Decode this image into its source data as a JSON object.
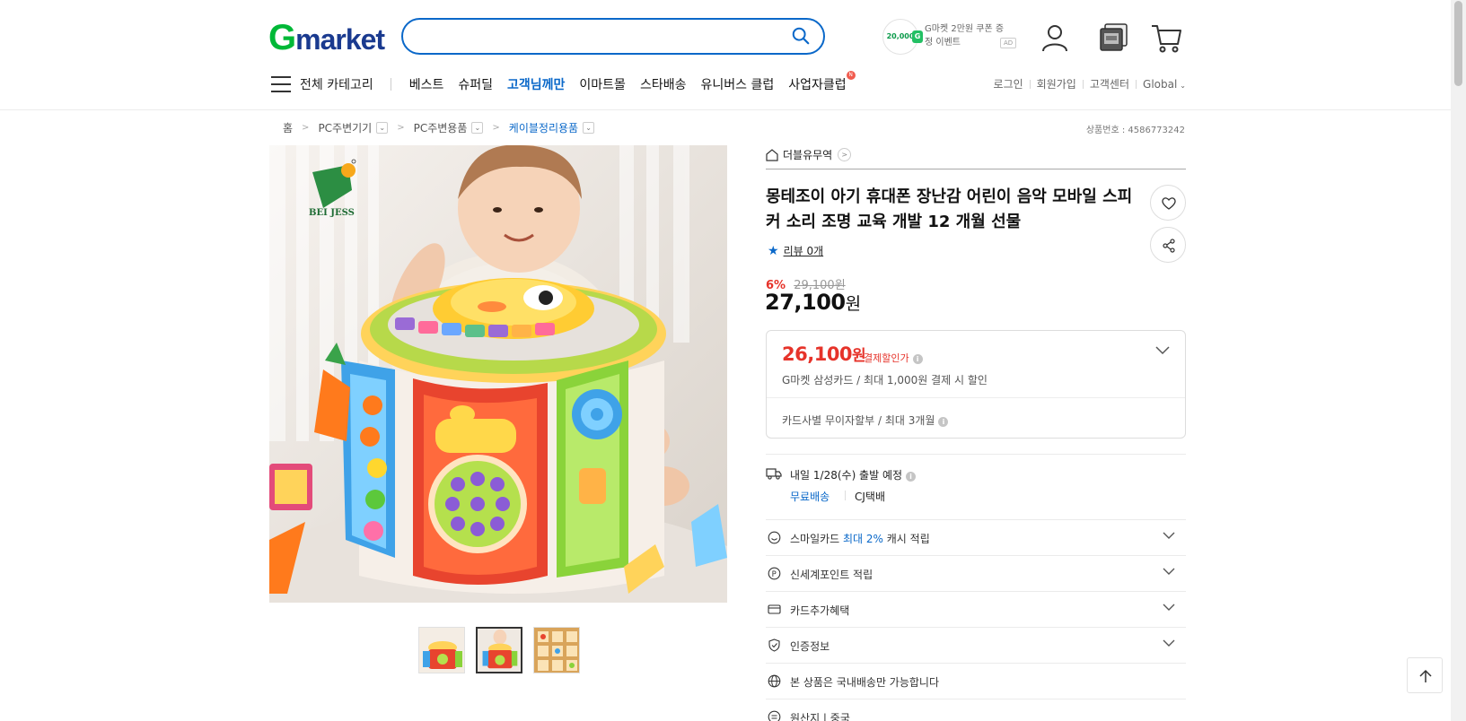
{
  "header": {
    "logo_g": "G",
    "logo_rest": "market",
    "search_placeholder": "",
    "promo_coin": "20,000",
    "promo_coin_g": "G",
    "promo_text": "G마켓 2만원 쿠폰 증정 이벤트",
    "ad_label": "AD"
  },
  "nav": {
    "category_label": "전체 카테고리",
    "items": [
      {
        "label": "베스트"
      },
      {
        "label": "슈퍼딜"
      },
      {
        "label": "고객님께만"
      },
      {
        "label": "이마트몰"
      },
      {
        "label": "스타배송"
      },
      {
        "label": "유니버스 클럽"
      },
      {
        "label": "사업자클럽"
      }
    ],
    "badge": "N",
    "util": [
      "로그인",
      "회원가입",
      "고객센터",
      "Global"
    ]
  },
  "breadcrumb": {
    "items": [
      "홈",
      "PC주변기기",
      "PC주변용품",
      "케이블정리용품"
    ],
    "product_number": "상품번호 : 4586773242"
  },
  "product": {
    "seller": "더블유무역",
    "title": "몽테조이 아기 휴대폰 장난감 어린이 음악 모바일 스피커 소리 조명 교육 개발 12 개월 선물",
    "review": "리뷰 0개",
    "discount_pct": "6%",
    "original_price": "29,100원",
    "price_value": "27,100",
    "price_unit": "원",
    "logo_text": "BEI JESS",
    "thumbnail_count": 3,
    "selected_thumbnail": 2
  },
  "payment": {
    "price_value": "26,100",
    "price_unit": "원",
    "label": "결제할인가",
    "sub": "G마켓 삼성카드 / 최대 1,000원 결제 시 할인",
    "installment": "카드사별 무이자할부 / 최대 3개월"
  },
  "shipping": {
    "date": "내일 1/28(수) 출발 예정",
    "free": "무료배송",
    "carrier": "CJ택배"
  },
  "rows": [
    {
      "prefix": "스마일카드 ",
      "highlight": "최대 2%",
      "suffix": " 캐시 적립"
    },
    {
      "label": "신세계포인트 적립"
    },
    {
      "label": "카드추가혜택"
    },
    {
      "label": "인증정보"
    },
    {
      "label": "본 상품은 국내배송만 가능합니다"
    },
    {
      "label": "원산지 | 중국"
    }
  ],
  "colors": {
    "brand_green": "#00b837",
    "brand_navy": "#1a3a8f",
    "accent_blue": "#0a68c9",
    "sale_red": "#e6332a"
  }
}
